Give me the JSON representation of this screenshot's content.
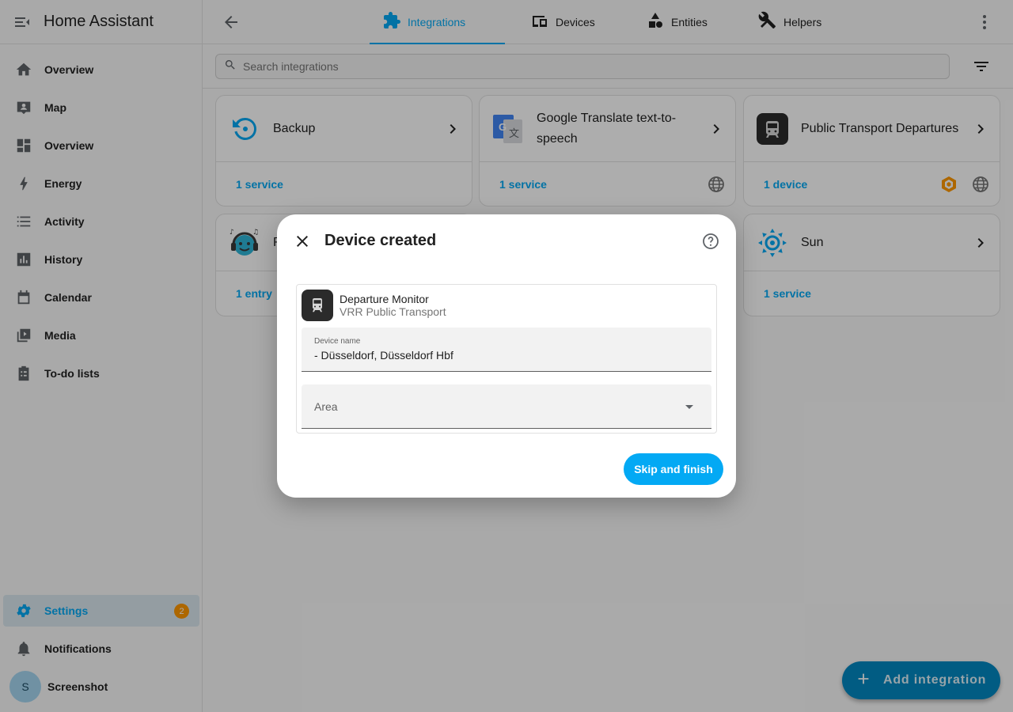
{
  "sidebar": {
    "app_title": "Home Assistant",
    "items": [
      {
        "label": "Overview",
        "icon": "home-icon"
      },
      {
        "label": "Map",
        "icon": "map-icon"
      },
      {
        "label": "Overview",
        "icon": "dashboard-icon"
      },
      {
        "label": "Energy",
        "icon": "lightning-icon"
      },
      {
        "label": "Activity",
        "icon": "list-icon"
      },
      {
        "label": "History",
        "icon": "chart-box-icon"
      },
      {
        "label": "Calendar",
        "icon": "calendar-icon"
      },
      {
        "label": "Media",
        "icon": "play-box-icon"
      },
      {
        "label": "To-do lists",
        "icon": "clipboard-list-icon"
      }
    ],
    "settings": {
      "label": "Settings",
      "badge": "2"
    },
    "notifications": {
      "label": "Notifications"
    },
    "user": {
      "initial": "S",
      "label": "Screenshot"
    }
  },
  "tabs": [
    {
      "label": "Integrations",
      "active": true
    },
    {
      "label": "Devices",
      "active": false
    },
    {
      "label": "Entities",
      "active": false
    },
    {
      "label": "Helpers",
      "active": false
    }
  ],
  "search": {
    "placeholder": "Search integrations"
  },
  "cards": [
    {
      "title": "Backup",
      "link": "1 service"
    },
    {
      "title": "Google Translate text-to-speech",
      "link": "1 service"
    },
    {
      "title": "Public Transport Departures",
      "link": "1 device"
    },
    {
      "title": "R",
      "link": "1 entry"
    },
    {
      "title": "Sun",
      "link": "1 service"
    }
  ],
  "fab": {
    "label": "Add integration"
  },
  "dialog": {
    "title": "Device created",
    "device_name": "Departure Monitor",
    "device_subtitle": "VRR Public Transport",
    "name_field_label": "Device name",
    "name_field_value": "- Düsseldorf, Düsseldorf Hbf",
    "area_field_label": "Area",
    "finish_button": "Skip and finish"
  },
  "colors": {
    "accent": "#03a9f4",
    "badge": "#ff9800",
    "fab": "#0288c2"
  }
}
